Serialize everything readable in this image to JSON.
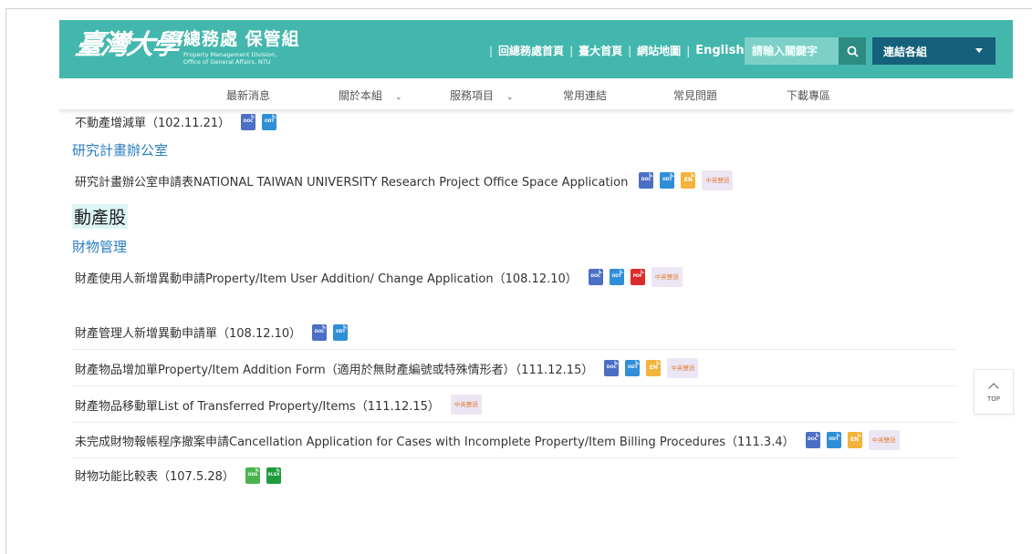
{
  "header": {
    "logo_script": "臺灣大學",
    "logo_title": "總務處 保管組",
    "logo_sub1": "Property Management Division,",
    "logo_sub2": "Office of General Affairs, NTU",
    "links": [
      "回總務處首頁",
      "臺大首頁",
      "網站地圖",
      "English"
    ],
    "search_placeholder": "請輸入關鍵字",
    "select_label": "連結各組"
  },
  "nav": [
    {
      "label": "最新消息",
      "has_dropdown": false
    },
    {
      "label": "關於本組",
      "has_dropdown": true
    },
    {
      "label": "服務項目",
      "has_dropdown": true
    },
    {
      "label": "常用連結",
      "has_dropdown": false
    },
    {
      "label": "常見問題",
      "has_dropdown": false
    },
    {
      "label": "下載專區",
      "has_dropdown": false
    }
  ],
  "content": {
    "row_real_estate": "不動產增減單（102.11.21）",
    "section_research": "研究計畫辦公室",
    "row_research": "研究計畫辦公室申請表NATIONAL TAIWAN UNIVERSITY Research Project Office Space Application",
    "section_movable": "動產股",
    "section_property_mgmt": "財物管理",
    "row_user_change": "財產使用人新增異動申請Property/Item User Addition/ Change Application（108.12.10）",
    "row_manager_change": "財產管理人新增異動申請單（108.12.10）",
    "row_addition": "財產物品增加單Property/Item Addition Form（適用於無財產編號或特殊情形者）（111.12.15）",
    "row_transfer": "財產物品移動單List of Transferred Property/Items（111.12.15）",
    "row_cancel": "未完成財物報帳程序撤案申請Cancellation Application for Cases with Incomplete Property/Item Billing Procedures（111.3.4）",
    "row_compare": "財物功能比較表（107.5.28）"
  },
  "file_labels": {
    "doc": "DOC",
    "odt": "ODT",
    "pdf": "PDF",
    "en": "EN",
    "ods": "ODS",
    "xlsx": "XLSX",
    "bilingual": "中英雙語"
  },
  "top_button": "TOP"
}
